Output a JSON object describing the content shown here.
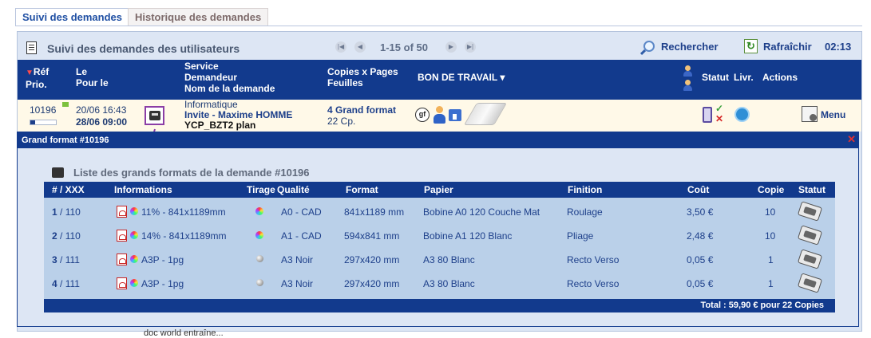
{
  "tabs": [
    {
      "label": "Suivi des demandes"
    },
    {
      "label": "Historique des demandes"
    }
  ],
  "toolbar": {
    "title": "Suivi des demandes des utilisateurs",
    "pager_text": "1-15 of 50",
    "search_label": "Rechercher",
    "refresh_label": "Rafraîchir",
    "clock": "02:13"
  },
  "header": {
    "ref_line1": "Réf",
    "ref_line2": "Prio.",
    "le_line1": "Le",
    "le_line2": "Pour le",
    "service_line1": "Service",
    "service_line2": "Demandeur",
    "service_line3": "Nom de la demande",
    "copies_line1": "Copies x Pages",
    "copies_line2": "Feuilles",
    "bon_de_travail": "BON DE TRAVAIL",
    "statut": "Statut",
    "livr": "Livr.",
    "actions": "Actions"
  },
  "request": {
    "ref": "10196",
    "progress": 0.2,
    "date_created": "20/06 16:43",
    "date_due": "28/06 09:00",
    "service": "Informatique",
    "requester": "Invite - Maxime HOMME",
    "name": "YCP_BZT2 plan",
    "copies_main": "4 Grand format",
    "copies_sub": "22 Cp.",
    "gf_badge": "gf",
    "menu_label": "Menu",
    "cut_text": "doc world entraîne..."
  },
  "popup": {
    "title": "Grand format #10196",
    "list_title": "Liste des grands formats de la demande #10196",
    "columns": [
      "# / XXX",
      "Informations",
      "Tirage",
      "Qualité",
      "Format",
      "Papier",
      "Finition",
      "Coût",
      "Copie",
      "Statut"
    ],
    "rows": [
      {
        "num": "1",
        "of": " / 110",
        "info": "11% - 841x1189mm",
        "tirage": "color",
        "qualite": "A0 - CAD",
        "format": "841x1189 mm",
        "papier": "Bobine A0 120 Couche Mat",
        "finition": "Roulage",
        "cout": "3,50 €",
        "copie": "10"
      },
      {
        "num": "2",
        "of": " / 110",
        "info": "14% - 841x1189mm",
        "tirage": "color",
        "qualite": "A1 - CAD",
        "format": "594x841 mm",
        "papier": "Bobine A1 120 Blanc",
        "finition": "Pliage",
        "cout": "2,48 €",
        "copie": "10"
      },
      {
        "num": "3",
        "of": " / 111",
        "info": "A3P  - 1pg",
        "tirage": "bw",
        "qualite": "A3 Noir",
        "format": "297x420 mm",
        "papier": "A3 80 Blanc",
        "finition": "Recto Verso",
        "cout": "0,05 €",
        "copie": "1"
      },
      {
        "num": "4",
        "of": " / 111",
        "info": "A3P  - 1pg",
        "tirage": "bw",
        "qualite": "A3 Noir",
        "format": "297x420 mm",
        "papier": "A3 80 Blanc",
        "finition": "Recto Verso",
        "cout": "0,05 €",
        "copie": "1"
      }
    ],
    "total": "Total : 59,90 € pour 22 Copies"
  },
  "colors": {
    "header_blue": "#123a8d",
    "panel_bg": "#dde6f4",
    "row_highlight": "#fff9e8",
    "table_bg": "#bad0e9",
    "annotation_purple": "#8b3ea6"
  }
}
